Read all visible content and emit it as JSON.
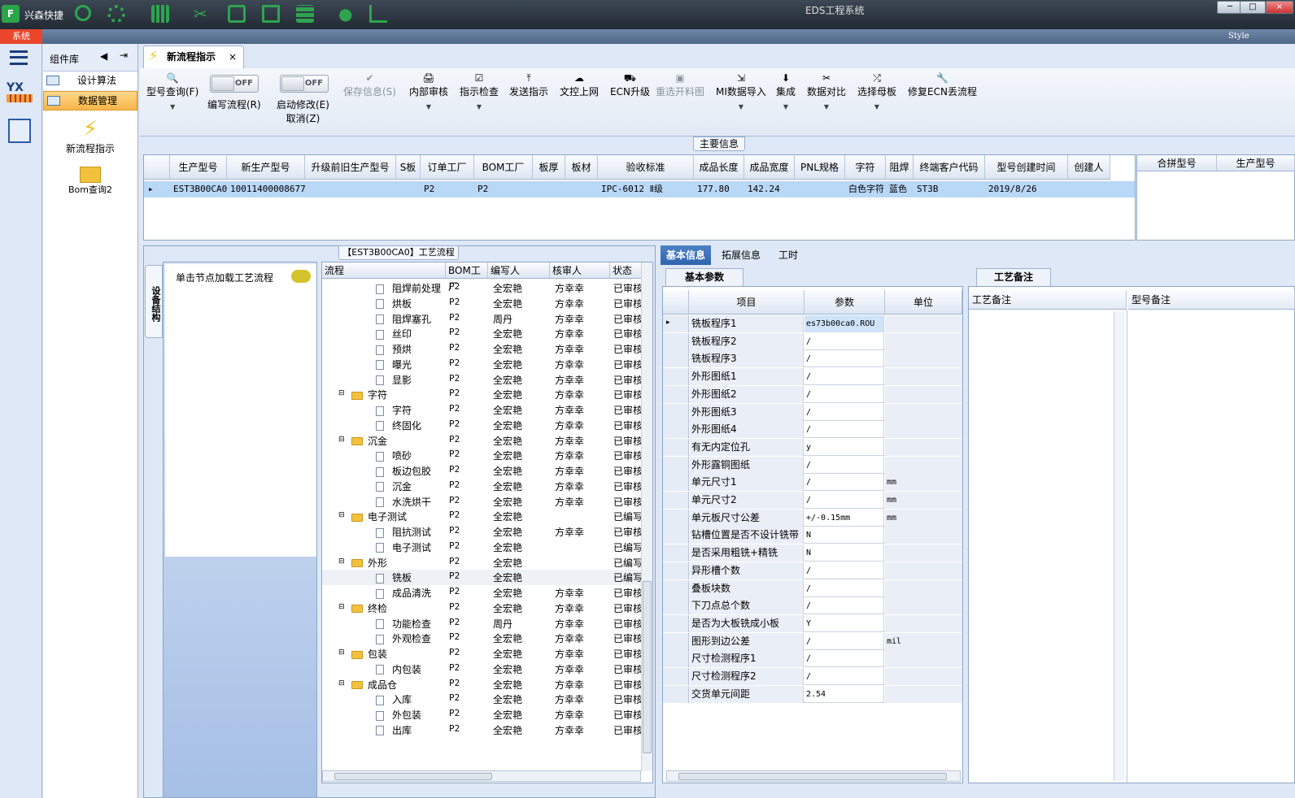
{
  "titlebar": {
    "app_name": "兴森快捷",
    "window_title": "EDS工程系统"
  },
  "ribbon": {
    "system_tab": "系统",
    "style_label": "Style"
  },
  "complib": {
    "title": "组件库",
    "items": [
      {
        "label": "设计算法"
      },
      {
        "label": "数据管理"
      }
    ],
    "tools": [
      {
        "label": "新流程指示"
      },
      {
        "label": "Bom查询2"
      }
    ]
  },
  "doc_tab": {
    "label": "新流程指示",
    "close": "×"
  },
  "toolbar": {
    "buttons": [
      {
        "label": "型号查询(F)",
        "icon": "🔍"
      },
      {
        "label": "编写流程(R)",
        "toggle": "OFF"
      },
      {
        "label": "启动修改(E)",
        "sub": "取消(Z)",
        "toggle": "OFF"
      },
      {
        "label": "保存信息(S)",
        "icon": "✔"
      },
      {
        "label": "内部审核",
        "icon": "🖨"
      },
      {
        "label": "指示检查",
        "icon": "☑"
      },
      {
        "label": "发送指示",
        "icon": "⤒"
      },
      {
        "label": "文控上网",
        "icon": "☁"
      },
      {
        "label": "ECN升级",
        "icon": "⛟"
      },
      {
        "label": "重选开料图",
        "icon": "▣"
      },
      {
        "label": "MI数据导入",
        "icon": "⇲"
      },
      {
        "label": "集成",
        "icon": "⬇"
      },
      {
        "label": "数据对比",
        "icon": "✂"
      },
      {
        "label": "选择母板",
        "icon": "⤮"
      },
      {
        "label": "修复ECN丢流程",
        "icon": "🔧"
      }
    ]
  },
  "main_info": {
    "label": "主要信息",
    "columns": [
      "生产型号",
      "新生产型号",
      "升级前旧生产型号",
      "S板",
      "订单工厂",
      "BOM工厂",
      "板厚",
      "板材",
      "验收标准",
      "成品长度",
      "成品宽度",
      "PNL规格",
      "字符",
      "阻焊",
      "终端客户代码",
      "型号创建时间",
      "创建人"
    ],
    "row": [
      "EST3B00CA0",
      "10011400008677",
      "",
      "",
      "P2",
      "P2",
      "",
      "",
      "IPC-6012 Ⅱ级",
      "177.80",
      "142.24",
      "",
      "白色字符",
      "蓝色",
      "ST3B",
      "2019/8/26",
      ""
    ],
    "merge_columns": [
      "合拼型号",
      "生产型号"
    ]
  },
  "flow": {
    "label": "【EST3B00CA0】工艺流程",
    "side_tab": "设备结构",
    "hint": "单击节点加载工艺流程",
    "columns": [
      "流程",
      "BOM工厂",
      "编写人",
      "核审人",
      "状态"
    ],
    "rows": [
      {
        "name": "阻焊前处理",
        "lvl": 2,
        "bom": "P2",
        "author": "全宏艳",
        "reviewer": "方幸幸",
        "status": "已审核"
      },
      {
        "name": "烘板",
        "lvl": 2,
        "bom": "P2",
        "author": "全宏艳",
        "reviewer": "方幸幸",
        "status": "已审核"
      },
      {
        "name": "阻焊塞孔",
        "lvl": 2,
        "bom": "P2",
        "author": "周丹",
        "reviewer": "方幸幸",
        "status": "已审核"
      },
      {
        "name": "丝印",
        "lvl": 2,
        "bom": "P2",
        "author": "全宏艳",
        "reviewer": "方幸幸",
        "status": "已审核"
      },
      {
        "name": "预烘",
        "lvl": 2,
        "bom": "P2",
        "author": "全宏艳",
        "reviewer": "方幸幸",
        "status": "已审核"
      },
      {
        "name": "曝光",
        "lvl": 2,
        "bom": "P2",
        "author": "全宏艳",
        "reviewer": "方幸幸",
        "status": "已审核"
      },
      {
        "name": "显影",
        "lvl": 2,
        "bom": "P2",
        "author": "全宏艳",
        "reviewer": "方幸幸",
        "status": "已审核"
      },
      {
        "name": "字符",
        "lvl": 1,
        "bom": "P2",
        "author": "全宏艳",
        "reviewer": "方幸幸",
        "status": "已审核"
      },
      {
        "name": "字符",
        "lvl": 2,
        "bom": "P2",
        "author": "全宏艳",
        "reviewer": "方幸幸",
        "status": "已审核"
      },
      {
        "name": "终固化",
        "lvl": 2,
        "bom": "P2",
        "author": "全宏艳",
        "reviewer": "方幸幸",
        "status": "已审核"
      },
      {
        "name": "沉金",
        "lvl": 1,
        "bom": "P2",
        "author": "全宏艳",
        "reviewer": "方幸幸",
        "status": "已审核"
      },
      {
        "name": "喷砂",
        "lvl": 2,
        "bom": "P2",
        "author": "全宏艳",
        "reviewer": "方幸幸",
        "status": "已审核"
      },
      {
        "name": "板边包胶",
        "lvl": 2,
        "bom": "P2",
        "author": "全宏艳",
        "reviewer": "方幸幸",
        "status": "已审核"
      },
      {
        "name": "沉金",
        "lvl": 2,
        "bom": "P2",
        "author": "全宏艳",
        "reviewer": "方幸幸",
        "status": "已审核"
      },
      {
        "name": "水洗烘干",
        "lvl": 2,
        "bom": "P2",
        "author": "全宏艳",
        "reviewer": "方幸幸",
        "status": "已审核"
      },
      {
        "name": "电子测试",
        "lvl": 1,
        "bom": "P2",
        "author": "全宏艳",
        "reviewer": "",
        "status": "已编写"
      },
      {
        "name": "阻抗测试",
        "lvl": 2,
        "bom": "P2",
        "author": "全宏艳",
        "reviewer": "方幸幸",
        "status": "已审核"
      },
      {
        "name": "电子测试",
        "lvl": 2,
        "bom": "P2",
        "author": "全宏艳",
        "reviewer": "",
        "status": "已编写"
      },
      {
        "name": "外形",
        "lvl": 1,
        "bom": "P2",
        "author": "全宏艳",
        "reviewer": "",
        "status": "已编写"
      },
      {
        "name": "铣板",
        "lvl": 2,
        "bom": "P2",
        "author": "全宏艳",
        "reviewer": "",
        "status": "已编写",
        "selected": true
      },
      {
        "name": "成品清洗",
        "lvl": 2,
        "bom": "P2",
        "author": "全宏艳",
        "reviewer": "方幸幸",
        "status": "已审核"
      },
      {
        "name": "终检",
        "lvl": 1,
        "bom": "P2",
        "author": "全宏艳",
        "reviewer": "方幸幸",
        "status": "已审核"
      },
      {
        "name": "功能检查",
        "lvl": 2,
        "bom": "P2",
        "author": "周丹",
        "reviewer": "方幸幸",
        "status": "已审核"
      },
      {
        "name": "外观检查",
        "lvl": 2,
        "bom": "P2",
        "author": "全宏艳",
        "reviewer": "方幸幸",
        "status": "已审核"
      },
      {
        "name": "包装",
        "lvl": 1,
        "bom": "P2",
        "author": "全宏艳",
        "reviewer": "方幸幸",
        "status": "已审核"
      },
      {
        "name": "内包装",
        "lvl": 2,
        "bom": "P2",
        "author": "全宏艳",
        "reviewer": "方幸幸",
        "status": "已审核"
      },
      {
        "name": "成品仓",
        "lvl": 1,
        "bom": "P2",
        "author": "全宏艳",
        "reviewer": "方幸幸",
        "status": "已审核"
      },
      {
        "name": "入库",
        "lvl": 2,
        "bom": "P2",
        "author": "全宏艳",
        "reviewer": "方幸幸",
        "status": "已审核"
      },
      {
        "name": "外包装",
        "lvl": 2,
        "bom": "P2",
        "author": "全宏艳",
        "reviewer": "方幸幸",
        "status": "已审核"
      },
      {
        "name": "出库",
        "lvl": 2,
        "bom": "P2",
        "author": "全宏艳",
        "reviewer": "方幸幸",
        "status": "已审核"
      }
    ]
  },
  "right": {
    "tabs": [
      "基本信息",
      "拓展信息",
      "工时"
    ],
    "param_tab": "基本参数",
    "param_columns": [
      "项目",
      "参数",
      "单位"
    ],
    "params": [
      {
        "item": "铣板程序1",
        "value": "es73b00ca0.ROU",
        "unit": "",
        "selected": true
      },
      {
        "item": "铣板程序2",
        "value": "/",
        "unit": ""
      },
      {
        "item": "铣板程序3",
        "value": "/",
        "unit": ""
      },
      {
        "item": "外形图纸1",
        "value": "/",
        "unit": ""
      },
      {
        "item": "外形图纸2",
        "value": "/",
        "unit": ""
      },
      {
        "item": "外形图纸3",
        "value": "/",
        "unit": ""
      },
      {
        "item": "外形图纸4",
        "value": "/",
        "unit": ""
      },
      {
        "item": "有无内定位孔",
        "value": "y",
        "unit": ""
      },
      {
        "item": "外形露铜图纸",
        "value": "/",
        "unit": ""
      },
      {
        "item": "单元尺寸1",
        "value": "/",
        "unit": "mm"
      },
      {
        "item": "单元尺寸2",
        "value": "/",
        "unit": "mm"
      },
      {
        "item": "单元板尺寸公差",
        "value": "+/-0.15mm",
        "unit": "mm"
      },
      {
        "item": "钻槽位置是否不设计铣带",
        "value": "N",
        "unit": ""
      },
      {
        "item": "是否采用粗铣+精铣",
        "value": "N",
        "unit": ""
      },
      {
        "item": "异形槽个数",
        "value": "/",
        "unit": ""
      },
      {
        "item": "叠板块数",
        "value": "/",
        "unit": ""
      },
      {
        "item": "下刀点总个数",
        "value": "/",
        "unit": ""
      },
      {
        "item": "是否为大板铣成小板",
        "value": "Y",
        "unit": ""
      },
      {
        "item": "图形到边公差",
        "value": "/",
        "unit": "mil"
      },
      {
        "item": "尺寸检测程序1",
        "value": "/",
        "unit": ""
      },
      {
        "item": "尺寸检测程序2",
        "value": "/",
        "unit": ""
      },
      {
        "item": "交货单元间距",
        "value": "2.54",
        "unit": ""
      }
    ],
    "note_tab": "工艺备注",
    "note_columns": [
      "工艺备注",
      "型号备注"
    ]
  },
  "colors": {
    "accent": "#2f64ad",
    "selected_row": "#b9d7f7",
    "active_item": "#f8b54a",
    "system_tab": "#e9462c"
  }
}
